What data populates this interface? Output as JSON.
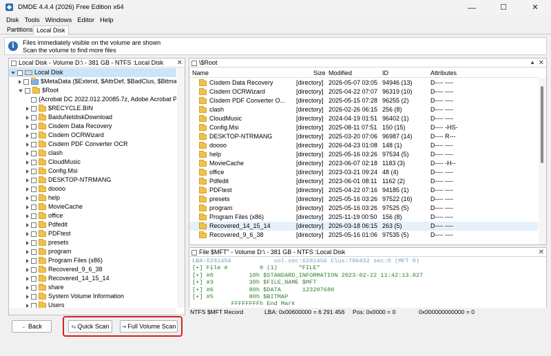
{
  "window": {
    "title": "DMDE 4.4.4 (2026) Free Edition x64",
    "minimize": "—",
    "maximize": "☐",
    "close": "✕"
  },
  "menu": [
    "Disk",
    "Tools",
    "Windows",
    "Editor",
    "Help"
  ],
  "tabs": [
    "Partitions",
    "Local Disk"
  ],
  "info": {
    "line1": "Files immediately visible on the volume are shown",
    "line2": "Scan the volume to find more files"
  },
  "tree": {
    "header": "Local Disk - Volume D:\\ - 381 GB - NTFS :Local Disk",
    "rows": [
      {
        "label": "Local Disk",
        "depth": 0,
        "kind": "drive",
        "expanded": true,
        "selected": true
      },
      {
        "label": "$MetaData ($Extend, $AttrDef, $BadClus, $Bitmap, $Bo",
        "depth": 1,
        "kind": "meta",
        "expanded": false
      },
      {
        "label": "$Root",
        "depth": 1,
        "kind": "folder",
        "expanded": true
      },
      {
        "label": "(Acrobat DC 2022.012.20085.7z, Adobe Acrobat Pro",
        "depth": 2,
        "kind": "none",
        "expanded": null
      },
      {
        "label": "$RECYCLE.BIN",
        "depth": 2,
        "kind": "folder",
        "expanded": false
      },
      {
        "label": "BaiduNetdiskDownload",
        "depth": 2,
        "kind": "folder",
        "expanded": false
      },
      {
        "label": "Cisdem Data Recovery",
        "depth": 2,
        "kind": "folder",
        "expanded": false
      },
      {
        "label": "Cisdem OCRWizard",
        "depth": 2,
        "kind": "folder",
        "expanded": false
      },
      {
        "label": "Cisdem PDF Converter OCR",
        "depth": 2,
        "kind": "folder",
        "expanded": false
      },
      {
        "label": "clash",
        "depth": 2,
        "kind": "folder",
        "expanded": false
      },
      {
        "label": "CloudMusic",
        "depth": 2,
        "kind": "folder",
        "expanded": false
      },
      {
        "label": "Config.Msi",
        "depth": 2,
        "kind": "folder",
        "expanded": false
      },
      {
        "label": "DESKTOP-NTRMANG",
        "depth": 2,
        "kind": "folder",
        "expanded": false
      },
      {
        "label": "doooo",
        "depth": 2,
        "kind": "folder",
        "expanded": false
      },
      {
        "label": "help",
        "depth": 2,
        "kind": "folder",
        "expanded": false
      },
      {
        "label": "MovieCache",
        "depth": 2,
        "kind": "folder",
        "expanded": false
      },
      {
        "label": "office",
        "depth": 2,
        "kind": "folder",
        "expanded": false
      },
      {
        "label": "Pdfedit",
        "depth": 2,
        "kind": "folder",
        "expanded": false
      },
      {
        "label": "PDFtest",
        "depth": 2,
        "kind": "folder",
        "expanded": false
      },
      {
        "label": "presets",
        "depth": 2,
        "kind": "folder",
        "expanded": false
      },
      {
        "label": "program",
        "depth": 2,
        "kind": "folder",
        "expanded": false
      },
      {
        "label": "Program Files (x86)",
        "depth": 2,
        "kind": "folder",
        "expanded": false
      },
      {
        "label": "Recovered_9_6_38",
        "depth": 2,
        "kind": "folder",
        "expanded": false
      },
      {
        "label": "Recovered_14_15_14",
        "depth": 2,
        "kind": "folder",
        "expanded": false
      },
      {
        "label": "share",
        "depth": 2,
        "kind": "folder",
        "expanded": false
      },
      {
        "label": "System Volume Information",
        "depth": 2,
        "kind": "folder",
        "expanded": false
      },
      {
        "label": "Users",
        "depth": 2,
        "kind": "folder",
        "expanded": false
      }
    ]
  },
  "list": {
    "header": "\\$Root",
    "columns": [
      "Name",
      "Size",
      "Modified",
      "ID",
      "Attributes"
    ],
    "rows": [
      {
        "name": "Cisdem Data Recovery",
        "size": "[directory]",
        "modified": "2026-05-07 03:05",
        "id": "94946 (13)",
        "attr": "D---- ----",
        "selected": false
      },
      {
        "name": "Cisdem OCRWizard",
        "size": "[directory]",
        "modified": "2025-04-22 07:07",
        "id": "96319 (10)",
        "attr": "D---- ----",
        "selected": false
      },
      {
        "name": "Cisdem PDF Converter O...",
        "size": "[directory]",
        "modified": "2025-05-15 07:28",
        "id": "96255 (2)",
        "attr": "D---- ----",
        "selected": false
      },
      {
        "name": "clash",
        "size": "[directory]",
        "modified": "2026-02-26 06:15",
        "id": "256 (8)",
        "attr": "D---- ----",
        "selected": false
      },
      {
        "name": "CloudMusic",
        "size": "[directory]",
        "modified": "2024-04-19 01:51",
        "id": "96402 (1)",
        "attr": "D---- ----",
        "selected": false
      },
      {
        "name": "Config.Msi",
        "size": "[directory]",
        "modified": "2025-08-11 07:51",
        "id": "150 (15)",
        "attr": "D---- -HS-",
        "selected": false
      },
      {
        "name": "DESKTOP-NTRMANG",
        "size": "[directory]",
        "modified": "2025-03-20 07:06",
        "id": "96987 (14)",
        "attr": "D---- R---",
        "selected": false
      },
      {
        "name": "doooo",
        "size": "[directory]",
        "modified": "2026-04-23 01:08",
        "id": "148 (1)",
        "attr": "D---- ----",
        "selected": false
      },
      {
        "name": "help",
        "size": "[directory]",
        "modified": "2025-05-16 03:26",
        "id": "97534 (5)",
        "attr": "D---- ----",
        "selected": false
      },
      {
        "name": "MovieCache",
        "size": "[directory]",
        "modified": "2023-06-07 02:18",
        "id": "1183 (3)",
        "attr": "D---- -H--",
        "selected": false
      },
      {
        "name": "office",
        "size": "[directory]",
        "modified": "2023-03-21 09:24",
        "id": "48 (4)",
        "attr": "D---- ----",
        "selected": false
      },
      {
        "name": "Pdfedit",
        "size": "[directory]",
        "modified": "2023-06-01 08:11",
        "id": "1162 (2)",
        "attr": "D---- ----",
        "selected": false
      },
      {
        "name": "PDFtest",
        "size": "[directory]",
        "modified": "2025-04-22 07:16",
        "id": "94185 (1)",
        "attr": "D---- ----",
        "selected": false
      },
      {
        "name": "presets",
        "size": "[directory]",
        "modified": "2025-05-16 03:26",
        "id": "97522 (16)",
        "attr": "D---- ----",
        "selected": false
      },
      {
        "name": "program",
        "size": "[directory]",
        "modified": "2025-05-16 03:26",
        "id": "97525 (5)",
        "attr": "D---- ----",
        "selected": false
      },
      {
        "name": "Program Files (x86)",
        "size": "[directory]",
        "modified": "2025-11-19 00:50",
        "id": "156 (8)",
        "attr": "D---- ----",
        "selected": false
      },
      {
        "name": "Recovered_14_15_14",
        "size": "[directory]",
        "modified": "2026-03-18 06:15",
        "id": "263 (5)",
        "attr": "D---- ----",
        "selected": true
      },
      {
        "name": "Recovered_9_6_38",
        "size": "[directory]",
        "modified": "2025-05-16 01:06",
        "id": "97535 (5)",
        "attr": "D---- ----",
        "selected": false
      }
    ]
  },
  "hex": {
    "header": "File $MFT\" - Volume D:\\ - 381 GB - NTFS :Local Disk",
    "lines": [
      "LBA:6291456            vol.sec:6291456 Clus:786432 sec:0 (MFT 0)",
      "[+] File #         0 (1)      \"FILE\"",
      "[+] #0          10h $STANDARD_INFORMATION 2023-02-22 11:42:13.827",
      "[+] #3          30h $FILE_NAME $MFT",
      "[+] #6          80h $DATA      123207680",
      "[+] #5          80h $BITMAP",
      "           FFFFFFFFh End Mark"
    ]
  },
  "status": {
    "left": "NTFS $MFT Record",
    "lba": "LBA: 0x00600000 = 6 291 456",
    "pos": "Pos: 0x0000 = 0",
    "right": "0x000000000000 = 0"
  },
  "buttons": {
    "back": "Back",
    "quick_scan": "Quick Scan",
    "full_scan": "Full Volume Scan"
  },
  "colors": {
    "accent": "#2f6db5",
    "highlight_border": "#d42020",
    "hex_text": "#2e7d32",
    "selection": "#cce4f7"
  }
}
